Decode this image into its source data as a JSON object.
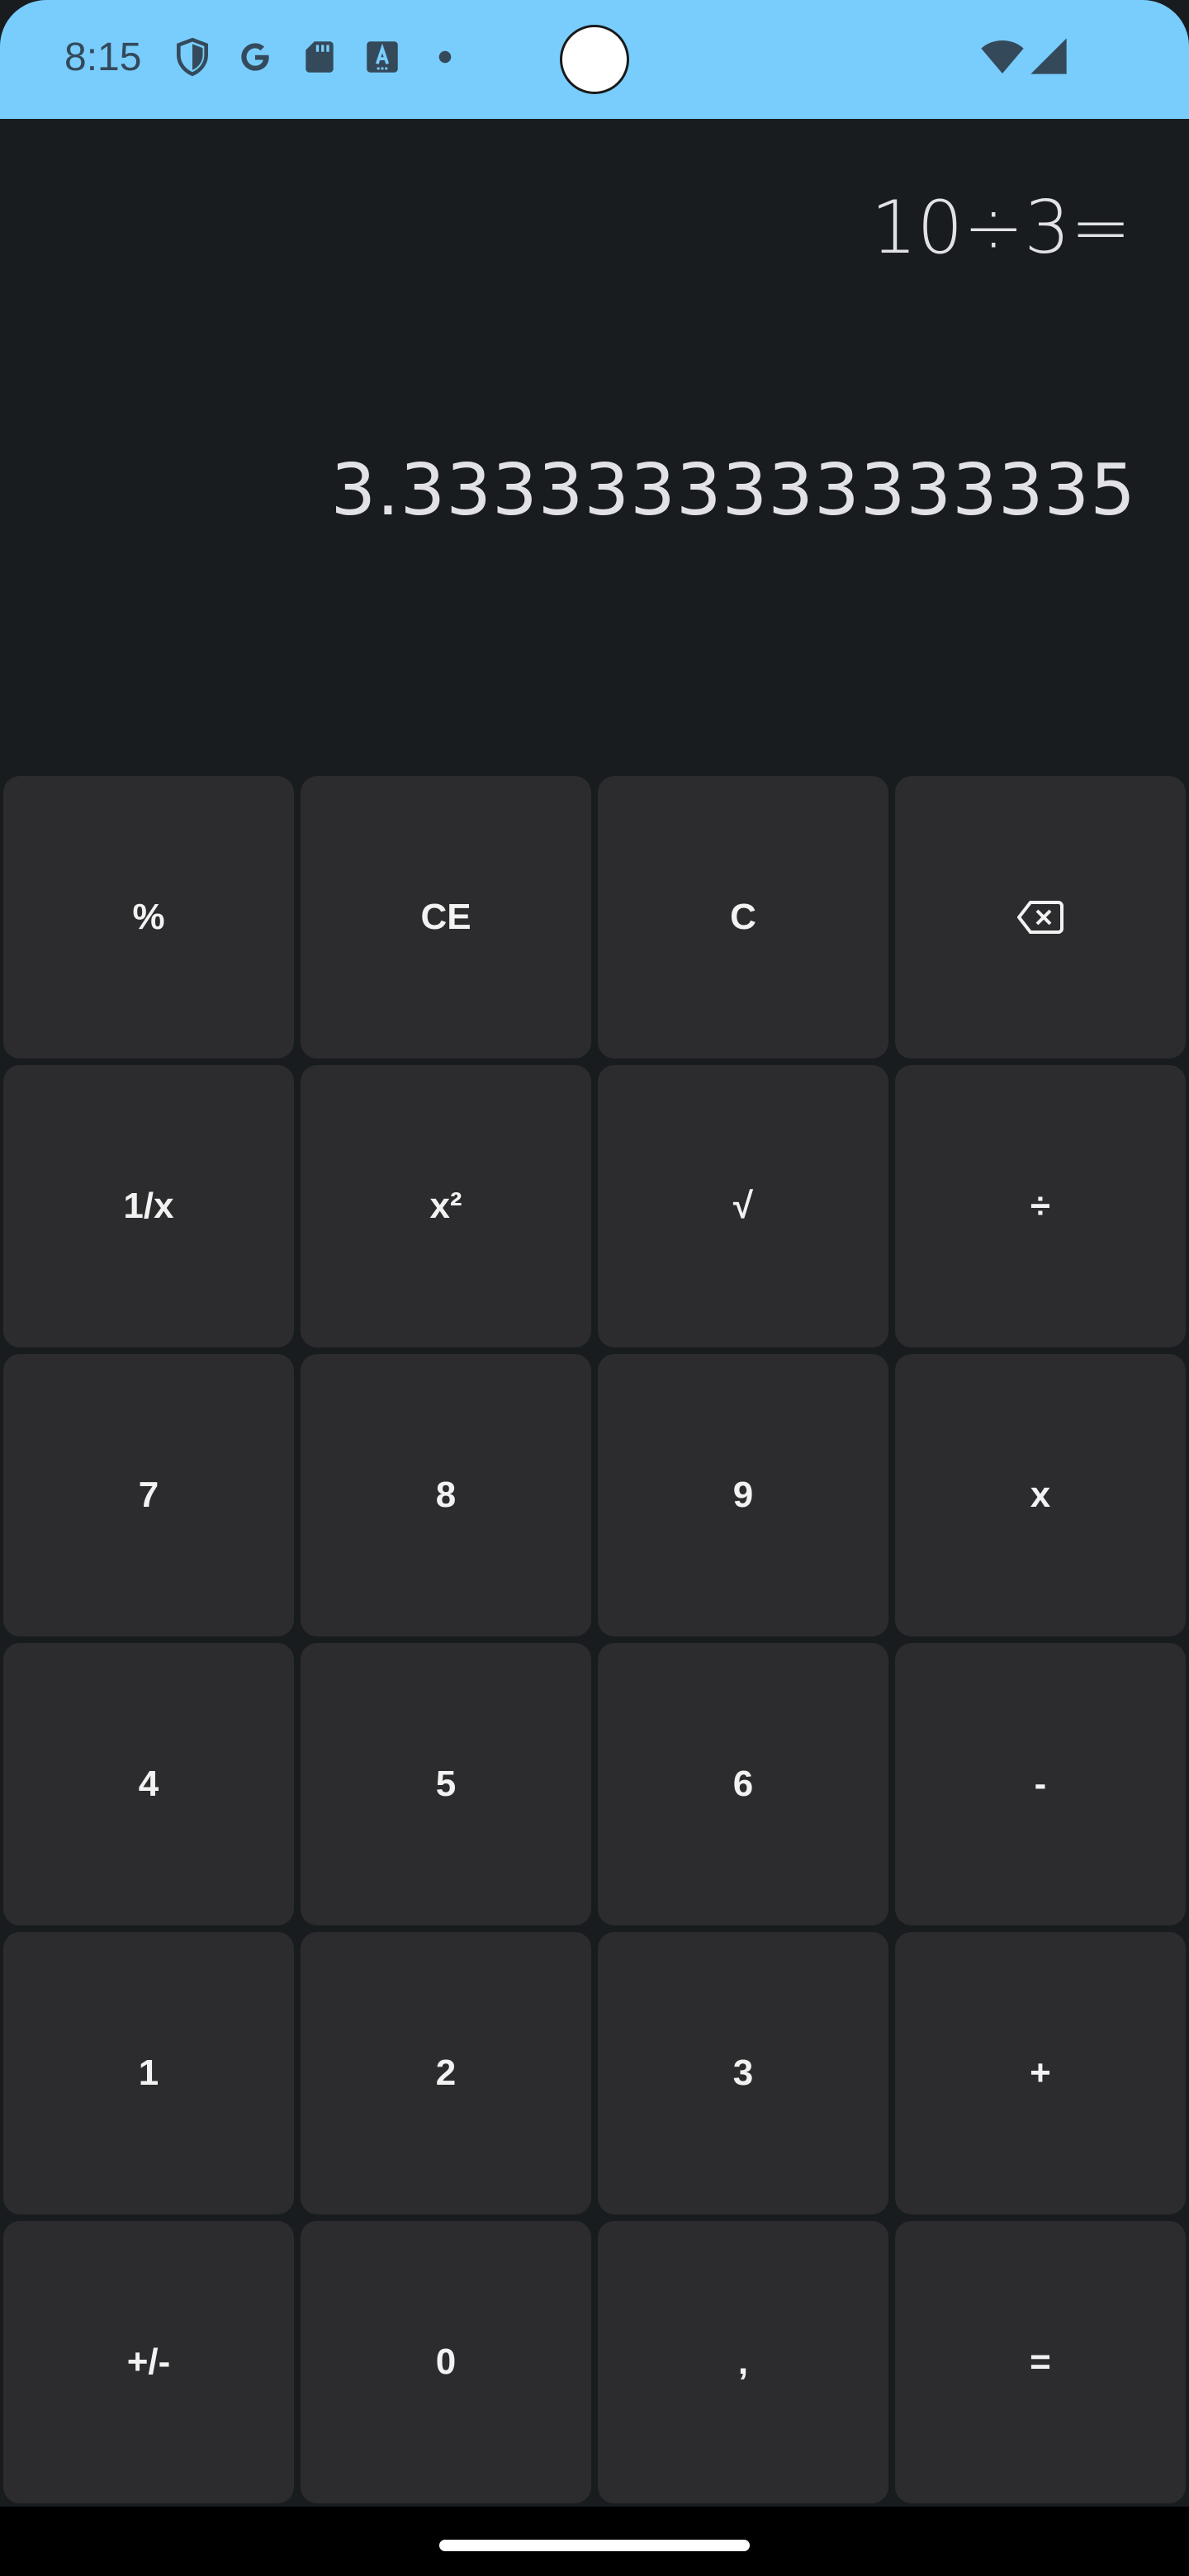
{
  "status_bar": {
    "time": "8:15",
    "icons_left": [
      "shield-icon",
      "google-icon",
      "sd-card-icon",
      "text-a-icon",
      "dot-icon"
    ],
    "icons_right": [
      "wifi-icon",
      "cellular-signal-icon"
    ],
    "background_color": "#78cdfd",
    "icon_color": "#34495a"
  },
  "display": {
    "expression": "10÷3=",
    "result": "3.3333333333333335"
  },
  "keypad": {
    "keys": [
      {
        "label": "%",
        "name": "percent-key"
      },
      {
        "label": "CE",
        "name": "clear-entry-key"
      },
      {
        "label": "C",
        "name": "clear-key"
      },
      {
        "label": "⌫",
        "name": "backspace-key"
      },
      {
        "label": "1/x",
        "name": "reciprocal-key"
      },
      {
        "label": "x²",
        "name": "square-key"
      },
      {
        "label": "√",
        "name": "square-root-key"
      },
      {
        "label": "÷",
        "name": "divide-key"
      },
      {
        "label": "7",
        "name": "digit-7-key"
      },
      {
        "label": "8",
        "name": "digit-8-key"
      },
      {
        "label": "9",
        "name": "digit-9-key"
      },
      {
        "label": "x",
        "name": "multiply-key"
      },
      {
        "label": "4",
        "name": "digit-4-key"
      },
      {
        "label": "5",
        "name": "digit-5-key"
      },
      {
        "label": "6",
        "name": "digit-6-key"
      },
      {
        "label": "-",
        "name": "subtract-key"
      },
      {
        "label": "1",
        "name": "digit-1-key"
      },
      {
        "label": "2",
        "name": "digit-2-key"
      },
      {
        "label": "3",
        "name": "digit-3-key"
      },
      {
        "label": "+",
        "name": "add-key"
      },
      {
        "label": "+/-",
        "name": "negate-key"
      },
      {
        "label": "0",
        "name": "digit-0-key"
      },
      {
        "label": ",",
        "name": "decimal-separator-key"
      },
      {
        "label": "=",
        "name": "equals-key"
      }
    ],
    "key_color": "#2c2c2e",
    "background_color": "#191c1f"
  }
}
